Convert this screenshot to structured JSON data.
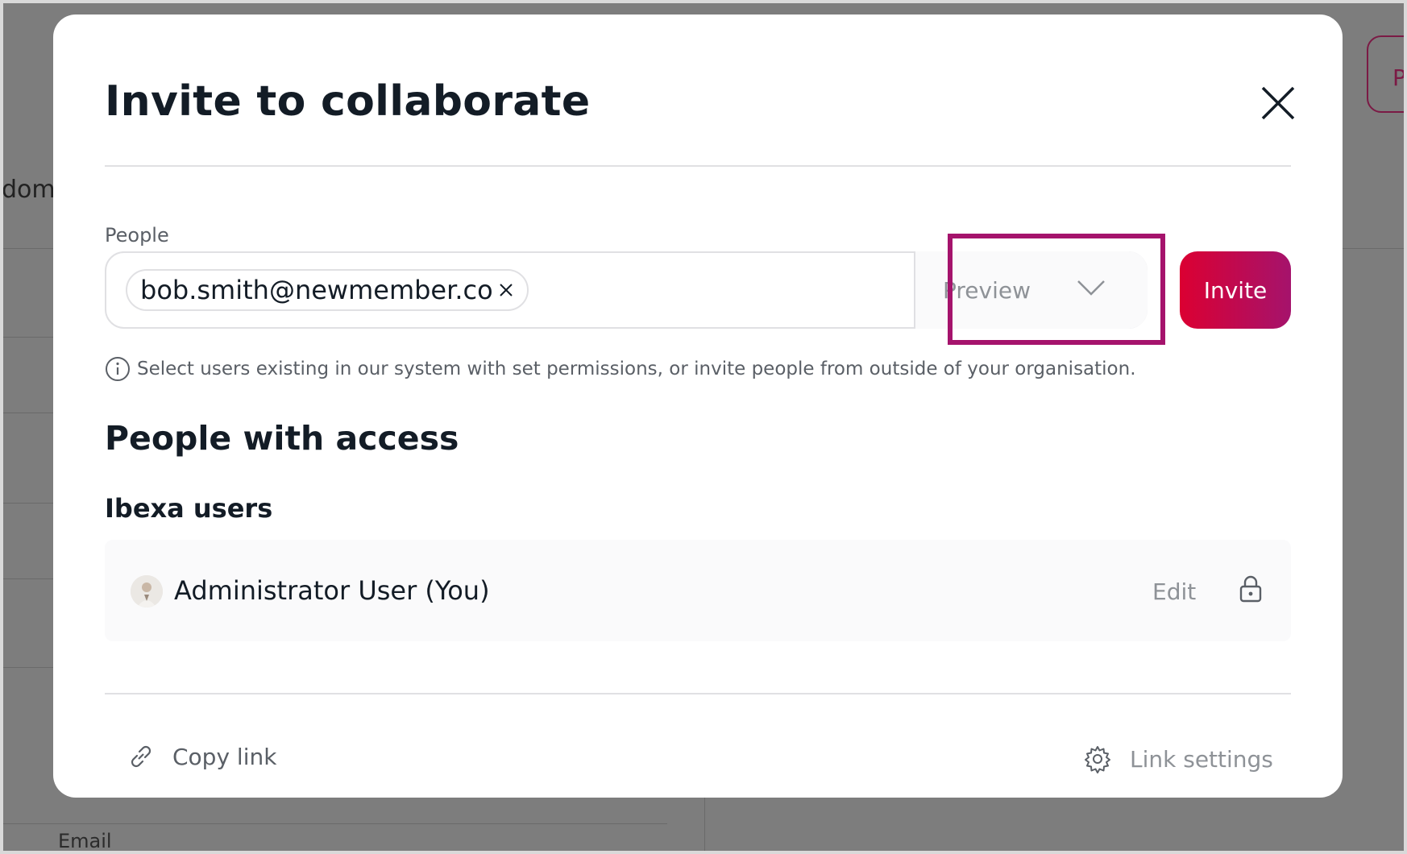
{
  "background": {
    "partial_text": "dom",
    "partial_button": "P",
    "email_label": "Email"
  },
  "modal": {
    "title": "Invite to collaborate",
    "people": {
      "label": "People",
      "chips": [
        {
          "value": "bob.smith@newmember.co"
        }
      ],
      "role_select": {
        "value": "Preview"
      },
      "invite_label": "Invite",
      "hint": "Select users existing in our system with set permissions, or invite people from outside of your organisation."
    },
    "access": {
      "title": "People with access",
      "group_title": "Ibexa users",
      "users": [
        {
          "name": "Administrator User (You)",
          "role": "Edit"
        }
      ]
    },
    "footer": {
      "copy_link": "Copy link",
      "link_settings": "Link settings"
    }
  },
  "colors": {
    "accent_start": "#db0032",
    "accent_end": "#a5136c",
    "highlight": "#a5136c"
  }
}
